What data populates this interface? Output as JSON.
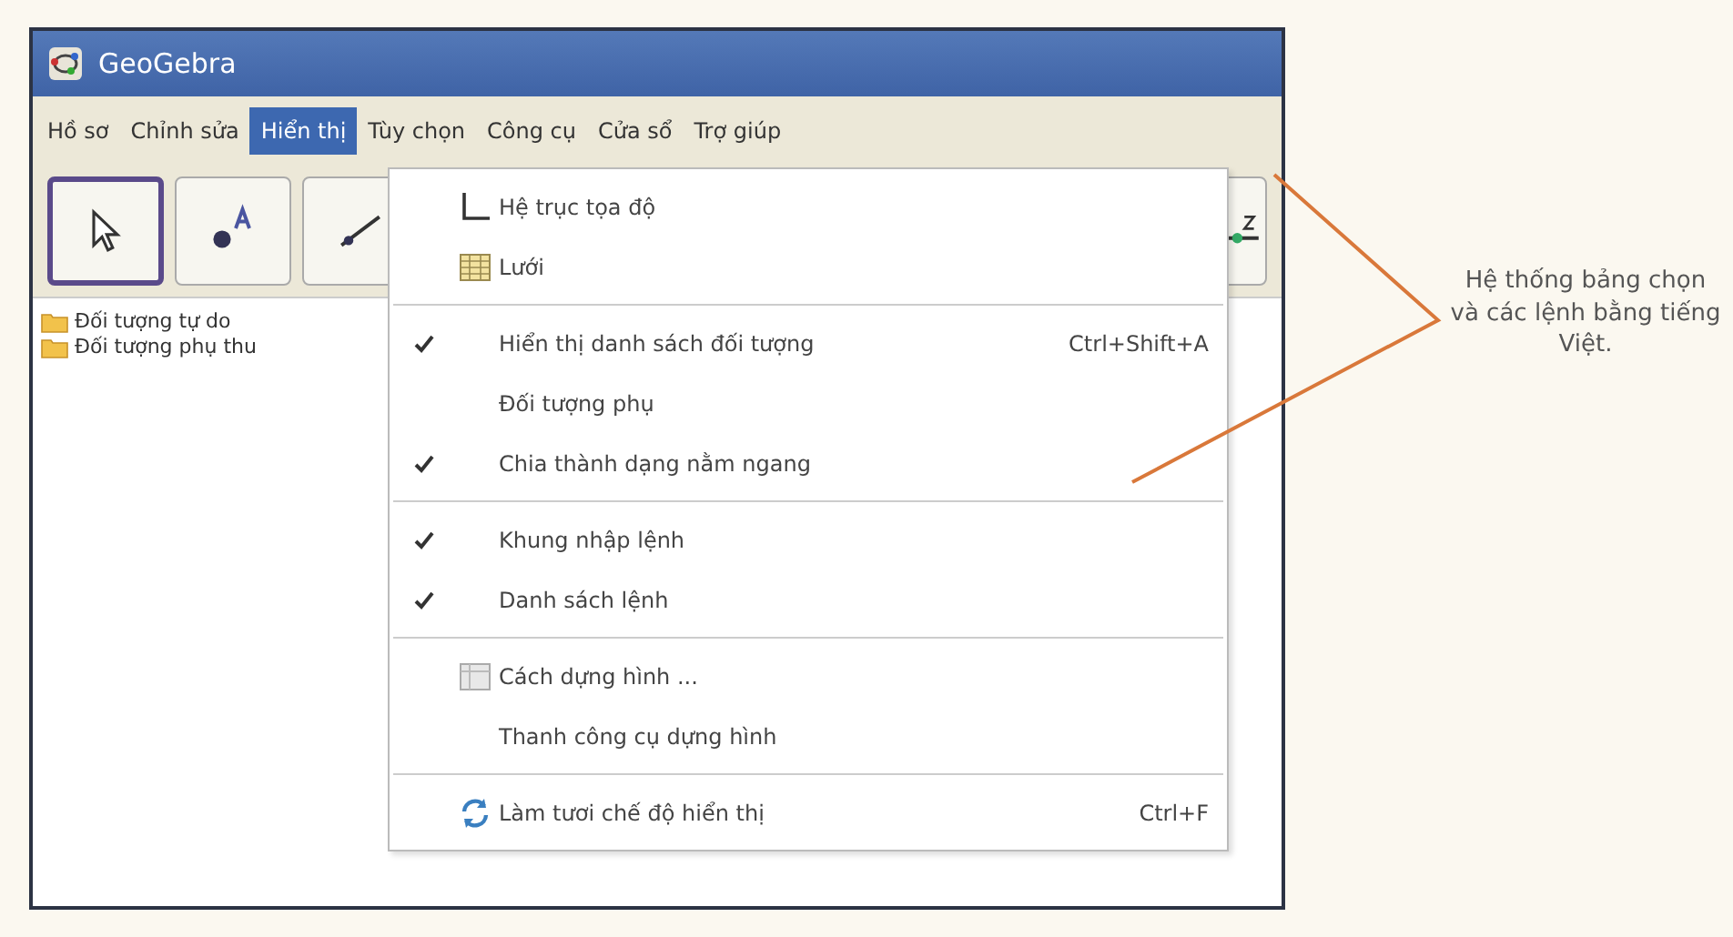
{
  "window": {
    "title": "GeoGebra"
  },
  "menubar": [
    {
      "label": "Hồ sơ",
      "selected": false
    },
    {
      "label": "Chỉnh sửa",
      "selected": false
    },
    {
      "label": "Hiển thị",
      "selected": true
    },
    {
      "label": "Tùy chọn",
      "selected": false
    },
    {
      "label": "Công cụ",
      "selected": false
    },
    {
      "label": "Cửa sổ",
      "selected": false
    },
    {
      "label": "Trợ giúp",
      "selected": false
    }
  ],
  "toolbar": [
    {
      "kind": "pointer",
      "selected": true
    },
    {
      "kind": "point",
      "selected": false
    },
    {
      "kind": "line",
      "selected": false
    },
    {
      "kind": "slider",
      "selected": false
    }
  ],
  "tree": [
    {
      "label": "Đối tượng tự do"
    },
    {
      "label": "Đối tượng phụ thu"
    }
  ],
  "menu": {
    "groups": [
      [
        {
          "label": "Hệ trục tọa độ",
          "kind": "axes",
          "checked": false
        },
        {
          "label": "Lưới",
          "kind": "grid",
          "checked": false
        }
      ],
      [
        {
          "label": "Hiển thị danh sách đối tượng",
          "checked": true,
          "shortcut": "Ctrl+Shift+A"
        },
        {
          "label": "Đối tượng phụ",
          "checked": false
        },
        {
          "label": "Chia thành dạng nằm ngang",
          "checked": true
        }
      ],
      [
        {
          "label": "Khung nhập lệnh",
          "checked": true
        },
        {
          "label": "Danh sách lệnh",
          "checked": true
        }
      ],
      [
        {
          "label": "Cách dựng hình ...",
          "kind": "table",
          "checked": false
        },
        {
          "label": "Thanh công cụ dựng hình",
          "checked": false
        }
      ],
      [
        {
          "label": "Làm tươi chế độ hiển thị",
          "kind": "refresh",
          "checked": false,
          "shortcut": "Ctrl+F"
        }
      ]
    ]
  },
  "callout": {
    "text": "Hệ thống bảng chọn và các lệnh bằng tiếng Việt."
  }
}
